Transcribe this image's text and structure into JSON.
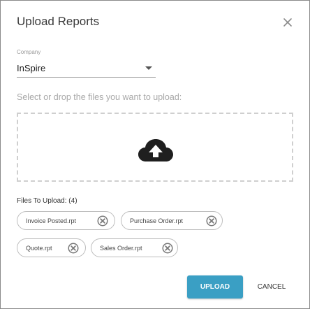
{
  "dialog": {
    "title": "Upload Reports",
    "close_icon": "close-icon"
  },
  "company": {
    "label": "Company",
    "value": "InSpire"
  },
  "dropzone": {
    "instructions": "Select or drop the files you want to upload:",
    "icon": "cloud-upload-icon"
  },
  "files": {
    "header": "Files To Upload: (4)",
    "items": [
      {
        "name": "Invoice Posted.rpt"
      },
      {
        "name": "Purchase Order.rpt"
      },
      {
        "name": "Quote.rpt"
      },
      {
        "name": "Sales Order.rpt"
      }
    ],
    "remove_icon": "remove-circle-icon"
  },
  "actions": {
    "upload_label": "UPLOAD",
    "cancel_label": "CANCEL"
  },
  "colors": {
    "primary": "#3a9fc4",
    "border": "#bdbdbd",
    "muted_text": "#a8a8a8"
  }
}
